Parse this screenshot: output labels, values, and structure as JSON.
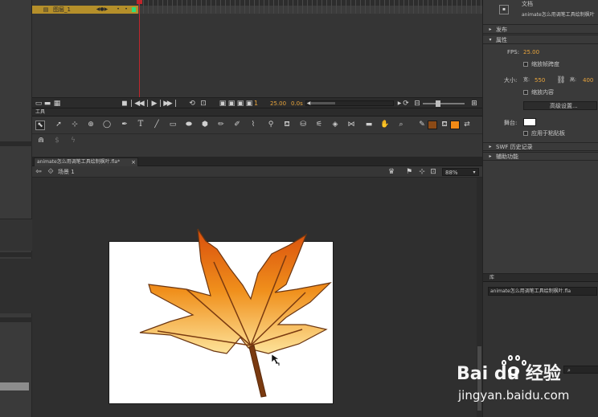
{
  "timeline": {
    "layer_name": "图层_1",
    "frame_number": "1",
    "fps_readout": "25.00",
    "time_readout": "0.0s"
  },
  "tools": {
    "panel_tab": "工具",
    "text_tool_glyph": "T"
  },
  "document": {
    "tab_title": "animate怎么用调笔工具绘制枫叶.fla*",
    "scene_label": "场景 1",
    "zoom": "88%"
  },
  "properties": {
    "doc_type": "文档",
    "doc_name": "animate怎么用调笔工具绘制枫叶",
    "section_publish": "发布",
    "section_properties": "属性",
    "fps_label": "FPS:",
    "fps_value": "25.00",
    "fps_checkbox_label": "缩放帧跨度",
    "size_label": "大小:",
    "width_label": "宽:",
    "width_value": "550",
    "height_label": "高:",
    "height_value": "400",
    "scale_checkbox_label": "缩放内容",
    "advanced_button": "高级设置...",
    "stage_label": "舞台:",
    "stage_checkbox_label": "应用于粘贴板",
    "section_swf": "SWF 历史记录",
    "section_accessibility": "辅助功能"
  },
  "library": {
    "panel_tab": "库",
    "file_dropdown": "animate怎么用调笔工具绘制枫叶.fla"
  },
  "watermark": {
    "logo_text": "Bai du 经验",
    "url": "jingyan.baidu.com"
  },
  "colors": {
    "accent_orange": "#e8a43c",
    "layer_highlight": "#b58f2a",
    "playhead": "#c0262c",
    "stroke_swatch": "#8b4a16",
    "fill_swatch": "#f08a16",
    "stage_bg": "#ffffff",
    "leaf_stroke": "#6b3612"
  }
}
